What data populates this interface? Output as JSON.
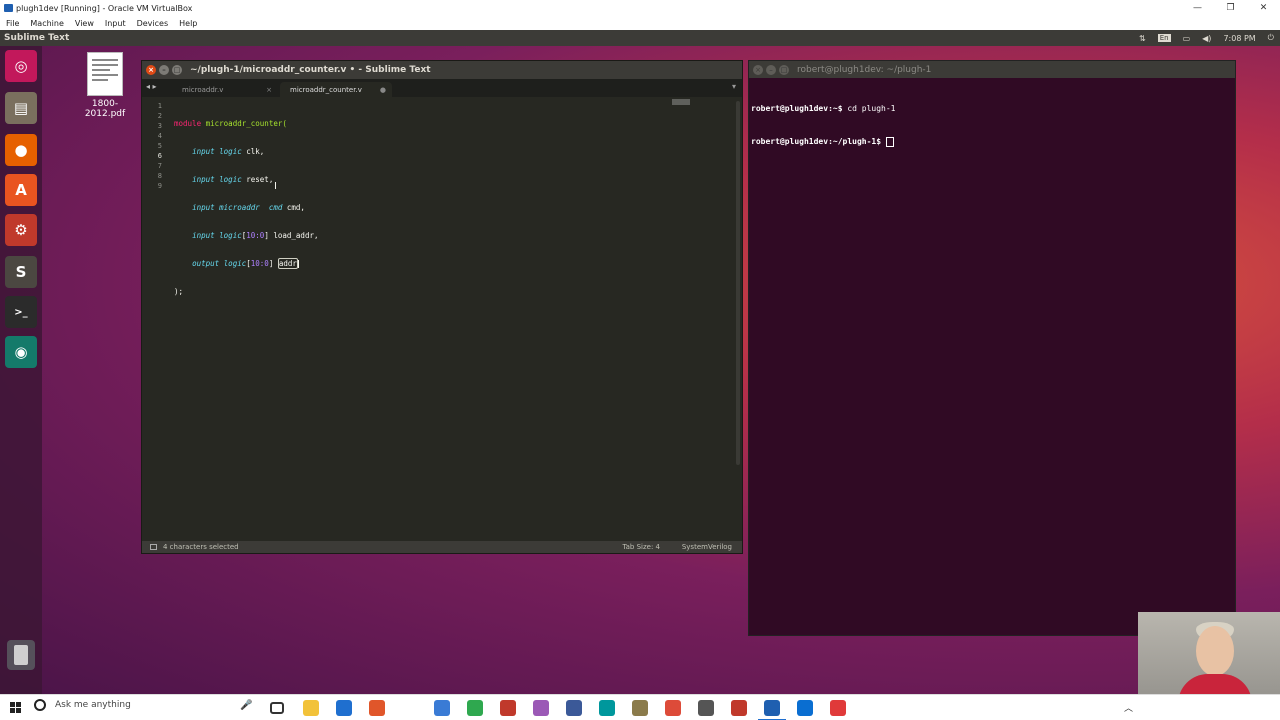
{
  "vbox": {
    "title": "plugh1dev [Running] - Oracle VM VirtualBox",
    "menu": [
      "File",
      "Machine",
      "View",
      "Input",
      "Devices",
      "Help"
    ],
    "controls": [
      "—",
      "❐",
      "✕"
    ]
  },
  "ubuntu": {
    "active_app": "Sublime Text",
    "tray": {
      "keyboard": "En",
      "time": "7:08 PM"
    },
    "launcher_icons": [
      {
        "name": "ubuntu-dash-icon",
        "glyph": "◎",
        "color": "#c2185b"
      },
      {
        "name": "files-icon",
        "glyph": "▤",
        "color": "#7a6f5e"
      },
      {
        "name": "firefox-icon",
        "glyph": "●",
        "color": "#e66000"
      },
      {
        "name": "software-center-icon",
        "glyph": "A",
        "color": "#e95420"
      },
      {
        "name": "settings-icon",
        "glyph": "⚙",
        "color": "#c0392b"
      },
      {
        "name": "sublime-text-icon",
        "glyph": "S",
        "color": "#4b4741"
      },
      {
        "name": "terminal-icon",
        "glyph": ">_",
        "color": "#2b2b2b"
      },
      {
        "name": "gitkraken-icon",
        "glyph": "◉",
        "color": "#147a6a"
      }
    ],
    "desktop_file": "1800-2012.pdf"
  },
  "sublime": {
    "title": "~/plugh-1/microaddr_counter.v • - Sublime Text",
    "tabs": [
      {
        "label": "microaddr.v",
        "close": "×"
      },
      {
        "label": "microaddr_counter.v",
        "close": "●"
      }
    ],
    "line_numbers": [
      "1",
      "2",
      "3",
      "4",
      "5",
      "6",
      "7",
      "8",
      "9"
    ],
    "code": {
      "l1_kw": "module",
      "l1_fn": "microaddr_counter(",
      "l2_kw": "input",
      "l2_ty": "logic",
      "l2_rest": " clk,",
      "l3_kw": "input",
      "l3_ty": "logic",
      "l3_rest": " reset,",
      "l4_kw": "input",
      "l4_ty": "microaddr  cmd",
      "l4_rest": " cmd,",
      "l5_kw": "input",
      "l5_ty": "logic",
      "l5_open": "[",
      "l5_num": "10:0",
      "l5_rest": "] load_addr,",
      "l6_kw": "output",
      "l6_ty": "logic",
      "l6_open": "[",
      "l6_num": "10:0",
      "l6_close": "] ",
      "l6_sel": "addr",
      "l7": ");"
    },
    "status": {
      "selection": "4 characters selected",
      "tab_size": "Tab Size: 4",
      "syntax": "SystemVerilog"
    }
  },
  "terminal": {
    "title": "robert@plugh1dev: ~/plugh-1",
    "line1_prompt": "robert@plugh1dev:~$",
    "line1_cmd": " cd plugh-1",
    "line2_prompt": "robert@plugh1dev:~/plugh-1$",
    "line2_cmd": " "
  },
  "taskbar": {
    "search_placeholder": "Ask me anything",
    "mic": "🎤",
    "apps": [
      {
        "name": "task-view-icon",
        "color": "#333333"
      },
      {
        "name": "file-explorer-icon",
        "color": "#f2c23a"
      },
      {
        "name": "store-icon",
        "color": "#1f6fcf"
      },
      {
        "name": "pdf-reader-icon",
        "color": "#e0562a"
      },
      {
        "name": "app-icon-blue",
        "color": "#3a7bd5"
      },
      {
        "name": "app-icon-green",
        "color": "#2fa84f"
      },
      {
        "name": "app-icon-red",
        "color": "#c0392b"
      },
      {
        "name": "app-icon-colorful",
        "color": "#9b59b6"
      },
      {
        "name": "vpn-icon",
        "color": "#3b5998"
      },
      {
        "name": "arduino-icon",
        "color": "#00979c"
      },
      {
        "name": "notepad-icon",
        "color": "#8b7b4b"
      },
      {
        "name": "chrome-icon",
        "color": "#dd4b39"
      },
      {
        "name": "screen-icon",
        "color": "#555555"
      },
      {
        "name": "tool-icon",
        "color": "#c0392b"
      },
      {
        "name": "virtualbox-icon",
        "color": "#1f5fb0"
      },
      {
        "name": "remote-icon",
        "color": "#0a6ed1"
      },
      {
        "name": "screencast-icon",
        "color": "#e03a3a"
      }
    ],
    "tray_arrow": "︿"
  }
}
